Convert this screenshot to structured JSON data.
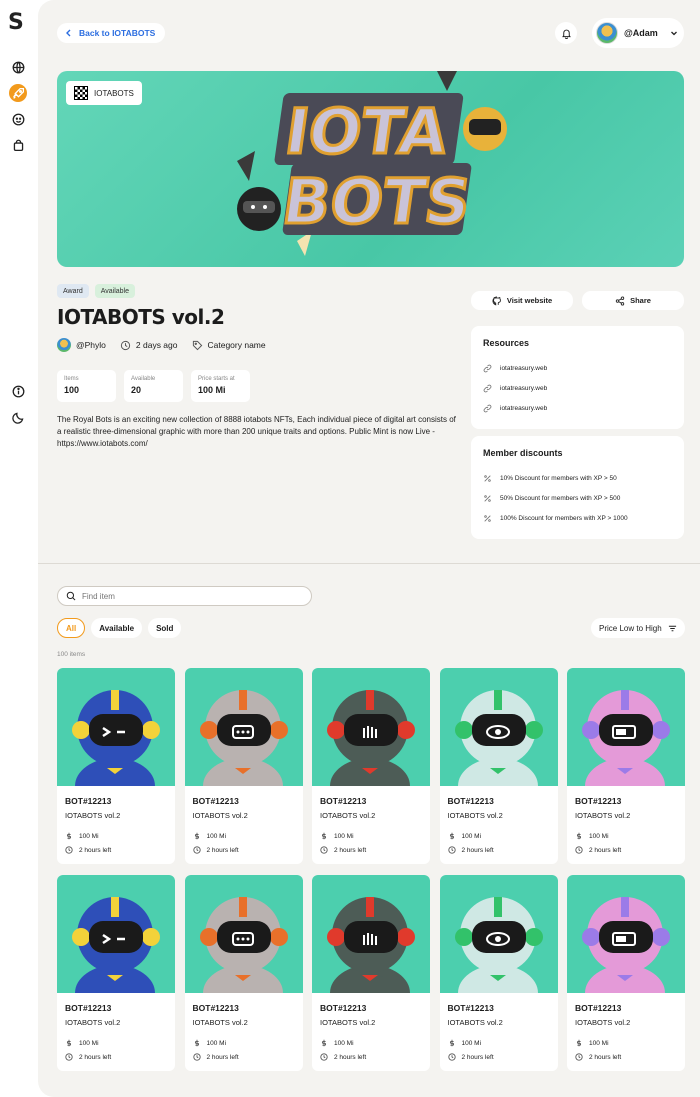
{
  "sidebar": {
    "logo": "S"
  },
  "header": {
    "back_label": "Back to IOTABOTS",
    "username": "@Adam"
  },
  "banner": {
    "tag_label": "IOTABOTS",
    "art_line1": "IOTA",
    "art_line2": "BOTS"
  },
  "collection": {
    "badges": [
      "Award",
      "Available"
    ],
    "title": "IOTABOTS vol.2",
    "author": "@Phylo",
    "posted": "2 days ago",
    "category": "Category name",
    "stats": [
      {
        "label": "Items",
        "value": "100"
      },
      {
        "label": "Available",
        "value": "20"
      },
      {
        "label": "Price starts at",
        "value": "100 Mi"
      }
    ],
    "description": "The Royal Bots is an exciting new collection of 8888 iotabots NFTs, Each individual piece of digital art consists of a realistic three-dimensional graphic with more than 200 unique traits and options. Public Mint is now Live - https://www.iotabots.com/"
  },
  "actions": {
    "visit_label": "Visit website",
    "share_label": "Share"
  },
  "resources": {
    "title": "Resources",
    "links": [
      "iotatreasury.web",
      "iotatreasury.web",
      "iotatreasury.web"
    ]
  },
  "discounts": {
    "title": "Member discounts",
    "items": [
      "10% Discount for members with XP > 50",
      "50% Discount for members with XP > 500",
      "100% Discount for members with XP > 1000"
    ]
  },
  "listing": {
    "search_placeholder": "Find item",
    "filters": [
      "All",
      "Available",
      "Sold"
    ],
    "sort_label": "Price Low to High",
    "count_label": "100 items"
  },
  "items": [
    {
      "name": "BOT#12213",
      "collection": "IOTABOTS vol.2",
      "price": "100 Mi",
      "time": "2 hours left",
      "body": "#2e4fb8",
      "accent": "#f3d23a",
      "visor": "#1a1a1a",
      "face": "wink"
    },
    {
      "name": "BOT#12213",
      "collection": "IOTABOTS vol.2",
      "price": "100 Mi",
      "time": "2 hours left",
      "body": "#b9b2b0",
      "accent": "#e8702a",
      "visor": "#1a1a1a",
      "face": "dots"
    },
    {
      "name": "BOT#12213",
      "collection": "IOTABOTS vol.2",
      "price": "100 Mi",
      "time": "2 hours left",
      "body": "#4d5c56",
      "accent": "#e03a2c",
      "visor": "#1a1a1a",
      "face": "hand"
    },
    {
      "name": "BOT#12213",
      "collection": "IOTABOTS vol.2",
      "price": "100 Mi",
      "time": "2 hours left",
      "body": "#cfe8e4",
      "accent": "#32c26a",
      "visor": "#1a1a1a",
      "face": "eye"
    },
    {
      "name": "BOT#12213",
      "collection": "IOTABOTS vol.2",
      "price": "100 Mi",
      "time": "2 hours left",
      "body": "#e49ad8",
      "accent": "#9b7be8",
      "visor": "#1a1a1a",
      "face": "battery"
    },
    {
      "name": "BOT#12213",
      "collection": "IOTABOTS vol.2",
      "price": "100 Mi",
      "time": "2 hours left",
      "body": "#2e4fb8",
      "accent": "#f3d23a",
      "visor": "#1a1a1a",
      "face": "wink"
    },
    {
      "name": "BOT#12213",
      "collection": "IOTABOTS vol.2",
      "price": "100 Mi",
      "time": "2 hours left",
      "body": "#b9b2b0",
      "accent": "#e8702a",
      "visor": "#1a1a1a",
      "face": "dots"
    },
    {
      "name": "BOT#12213",
      "collection": "IOTABOTS vol.2",
      "price": "100 Mi",
      "time": "2 hours left",
      "body": "#4d5c56",
      "accent": "#e03a2c",
      "visor": "#1a1a1a",
      "face": "hand"
    },
    {
      "name": "BOT#12213",
      "collection": "IOTABOTS vol.2",
      "price": "100 Mi",
      "time": "2 hours left",
      "body": "#cfe8e4",
      "accent": "#32c26a",
      "visor": "#1a1a1a",
      "face": "eye"
    },
    {
      "name": "BOT#12213",
      "collection": "IOTABOTS vol.2",
      "price": "100 Mi",
      "time": "2 hours left",
      "body": "#e49ad8",
      "accent": "#9b7be8",
      "visor": "#1a1a1a",
      "face": "battery"
    }
  ]
}
